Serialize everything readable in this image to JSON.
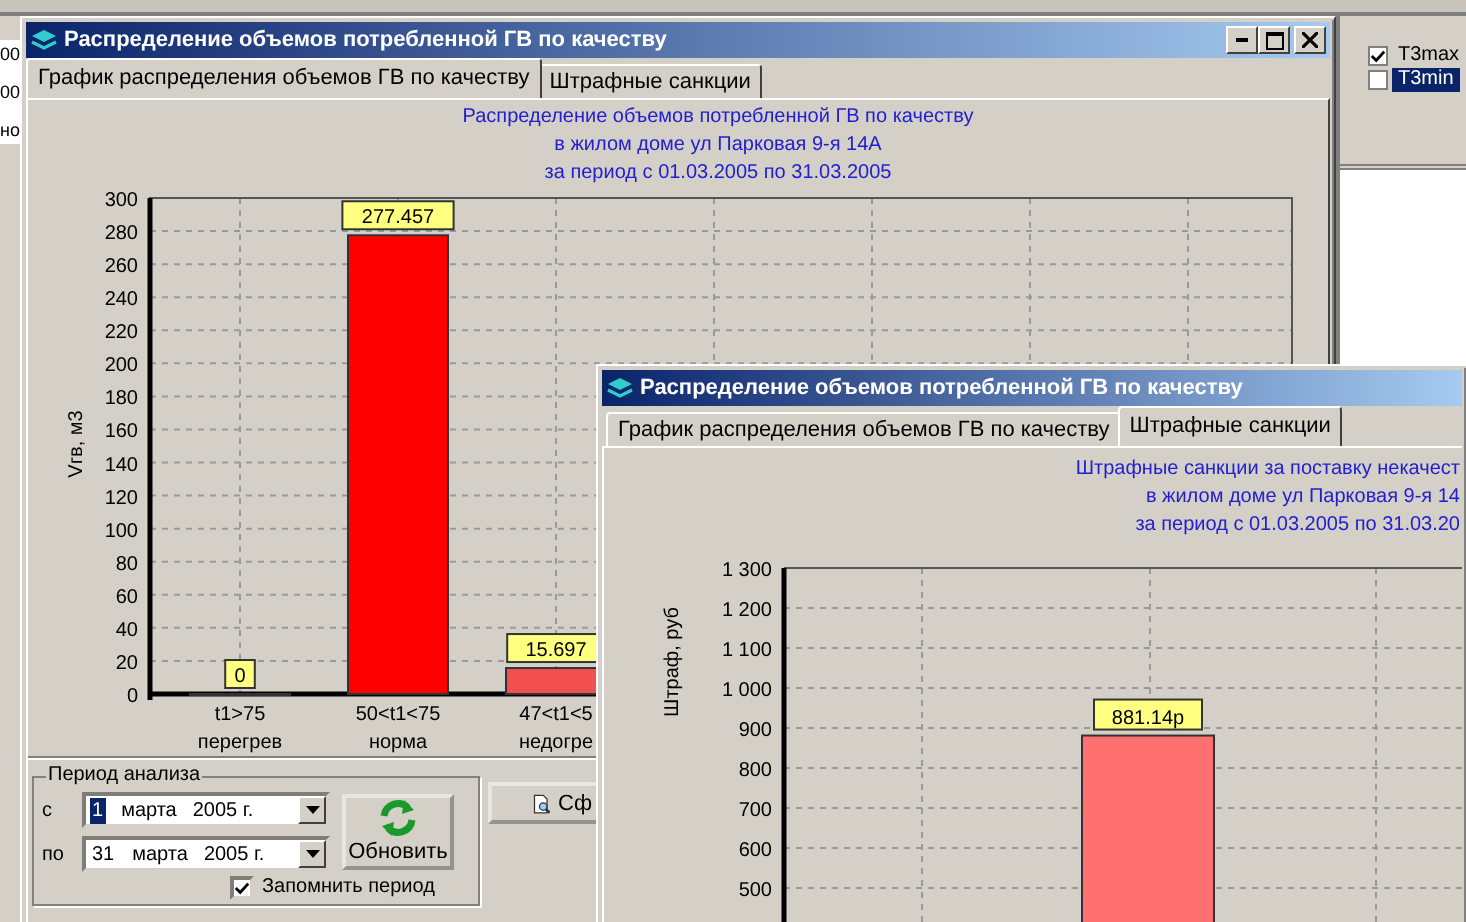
{
  "background_app": {
    "left_fields": [
      "00",
      "00",
      "но"
    ],
    "series_list": [
      {
        "label": "T3max",
        "checked": true,
        "selected": false
      },
      {
        "label": "T3min",
        "checked": false,
        "selected": true
      }
    ]
  },
  "main_window": {
    "title": "Распределение объемов потребленной ГВ по качеству",
    "tabs": [
      {
        "label": "График распределения объемов ГВ по качеству",
        "selected": true
      },
      {
        "label": "Штрафные санкции",
        "selected": false
      }
    ],
    "chart_title": [
      "Распределение объемов потребленной ГВ по качеству",
      "в жилом доме ул Парковая 9-я 14А",
      "за период с 01.03.2005 по 31.03.2005"
    ],
    "chart_data": {
      "type": "bar",
      "ylabel": "Vгв, м3",
      "categories": [
        "t1>75\nперегрев",
        "50<t1<75\nнорма",
        "47<t1<5\nнедогре"
      ],
      "grid": true,
      "series": [
        {
          "color": "#ff0000",
          "values": [
            0,
            277.457,
            null
          ]
        },
        {
          "color": "#f25050",
          "values": [
            null,
            null,
            15.697
          ]
        }
      ],
      "ylim": [
        0,
        300
      ],
      "yticks": [
        0,
        20,
        40,
        60,
        80,
        100,
        120,
        140,
        160,
        180,
        200,
        220,
        240,
        260,
        280,
        300
      ],
      "value_labels": [
        "0",
        "277.457",
        "15.697"
      ]
    },
    "period": {
      "legend": "Период анализа",
      "rows": [
        {
          "label": "с",
          "day": "1",
          "day_selected": true,
          "month": "марта",
          "year": "2005 г."
        },
        {
          "label": "по",
          "day": "31",
          "day_selected": false,
          "month": "марта",
          "year": "2005 г."
        }
      ],
      "refresh_button": "Обновить",
      "remember": {
        "label": "Запомнить период",
        "checked": true
      }
    },
    "report_button": "Сф"
  },
  "penalty_window": {
    "title": "Распределение объемов потребленной ГВ по качеству",
    "tabs": [
      {
        "label": "График распределения объемов ГВ по качеству",
        "selected": false
      },
      {
        "label": "Штрафные санкции",
        "selected": true
      }
    ],
    "chart_title": [
      "Штрафные санкции за поставку некачест",
      "в жилом доме ул Парковая 9-я 14",
      "за период с 01.03.2005 по 31.03.20"
    ],
    "chart_data": {
      "type": "bar",
      "ylabel": "Штраф, руб",
      "grid": true,
      "series": [
        {
          "color": "#ff7070",
          "values": [
            881.14
          ]
        }
      ],
      "ylim": [
        0,
        1300
      ],
      "yticks": [
        {
          "value": 500,
          "label": "500"
        },
        {
          "value": 600,
          "label": "600"
        },
        {
          "value": 700,
          "label": "700"
        },
        {
          "value": 800,
          "label": "800"
        },
        {
          "value": 900,
          "label": "900"
        },
        {
          "value": 1000,
          "label": "1 000"
        },
        {
          "value": 1100,
          "label": "1 100"
        },
        {
          "value": 1200,
          "label": "1 200"
        },
        {
          "value": 1300,
          "label": "1 300"
        }
      ],
      "value_labels": [
        "881.14р"
      ]
    }
  }
}
